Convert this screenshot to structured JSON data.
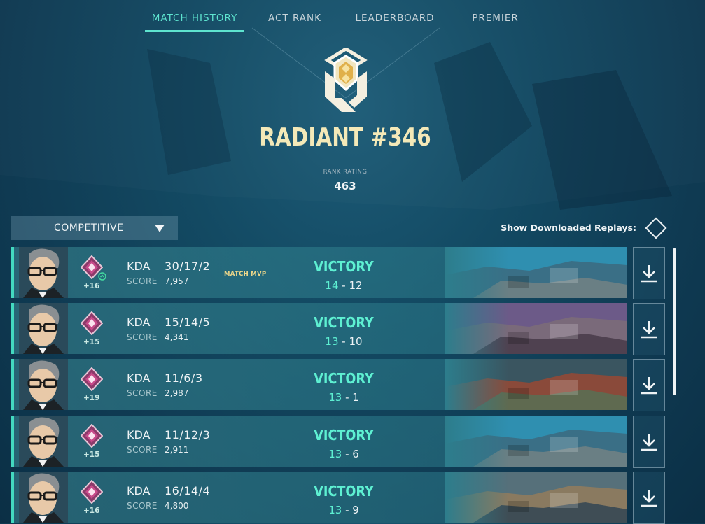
{
  "tabs": [
    {
      "label": "MATCH HISTORY",
      "active": true
    },
    {
      "label": "ACT RANK",
      "active": false
    },
    {
      "label": "LEADERBOARD",
      "active": false
    },
    {
      "label": "PREMIER",
      "active": false
    }
  ],
  "rank": {
    "title": "RADIANT #346",
    "rating_label": "RANK RATING",
    "rating_value": "463",
    "icon": "radiant-rank-icon"
  },
  "filter": {
    "queue": "COMPETITIVE",
    "replays_label": "Show Downloaded Replays:"
  },
  "colors": {
    "accent": "#5ee4cf",
    "victory": "#5ef0d2",
    "rank_gold": "#f4e9b8",
    "mvp_gold": "#f1d98a"
  },
  "matches": [
    {
      "rr": "+16",
      "kda_label": "KDA",
      "k": "30",
      "d": "17",
      "a": "2",
      "score_label": "SCORE",
      "score": "7,957",
      "mvp": "MATCH MVP",
      "result": "VICTORY",
      "team_score": "14",
      "enemy_score": "12",
      "map": "map-thumbnail-1",
      "level_up": true
    },
    {
      "rr": "+15",
      "kda_label": "KDA",
      "k": "15",
      "d": "14",
      "a": "5",
      "score_label": "SCORE",
      "score": "4,341",
      "mvp": "",
      "result": "VICTORY",
      "team_score": "13",
      "enemy_score": "10",
      "map": "map-thumbnail-2",
      "level_up": false
    },
    {
      "rr": "+19",
      "kda_label": "KDA",
      "k": "11",
      "d": "6",
      "a": "3",
      "score_label": "SCORE",
      "score": "2,987",
      "mvp": "",
      "result": "VICTORY",
      "team_score": "13",
      "enemy_score": "1",
      "map": "map-thumbnail-3",
      "level_up": false
    },
    {
      "rr": "+15",
      "kda_label": "KDA",
      "k": "11",
      "d": "12",
      "a": "3",
      "score_label": "SCORE",
      "score": "2,911",
      "mvp": "",
      "result": "VICTORY",
      "team_score": "13",
      "enemy_score": "6",
      "map": "map-thumbnail-1",
      "level_up": false
    },
    {
      "rr": "+16",
      "kda_label": "KDA",
      "k": "16",
      "d": "14",
      "a": "4",
      "score_label": "SCORE",
      "score": "4,800",
      "mvp": "",
      "result": "VICTORY",
      "team_score": "13",
      "enemy_score": "9",
      "map": "map-thumbnail-4",
      "level_up": false
    }
  ]
}
